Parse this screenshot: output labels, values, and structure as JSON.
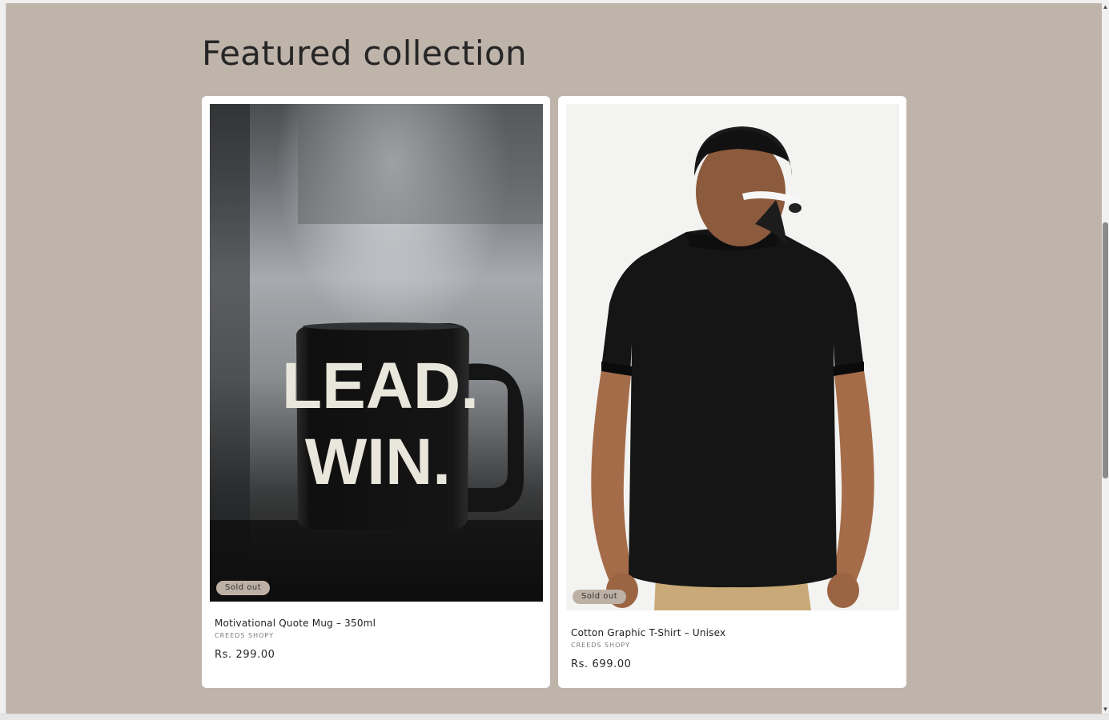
{
  "section": {
    "title": "Featured collection"
  },
  "products": [
    {
      "title": "Motivational Quote Mug – 350ml",
      "vendor": "CREEDS SHOPY",
      "price": "Rs. 299.00",
      "badge": "Sold out",
      "image_text_line1": "LEAD.",
      "image_text_line2": "WIN."
    },
    {
      "title": "Cotton Graphic T-Shirt – Unisex",
      "vendor": "CREEDS SHOPY",
      "price": "Rs. 699.00",
      "badge": "Sold out"
    }
  ],
  "colors": {
    "page_background": "#bfb4aa",
    "card_background": "#ffffff",
    "badge_background": "#bdb1a6",
    "text": "#262626"
  },
  "icons": {
    "scroll_up": "triangle-up-icon",
    "scroll_down": "triangle-down-icon"
  }
}
